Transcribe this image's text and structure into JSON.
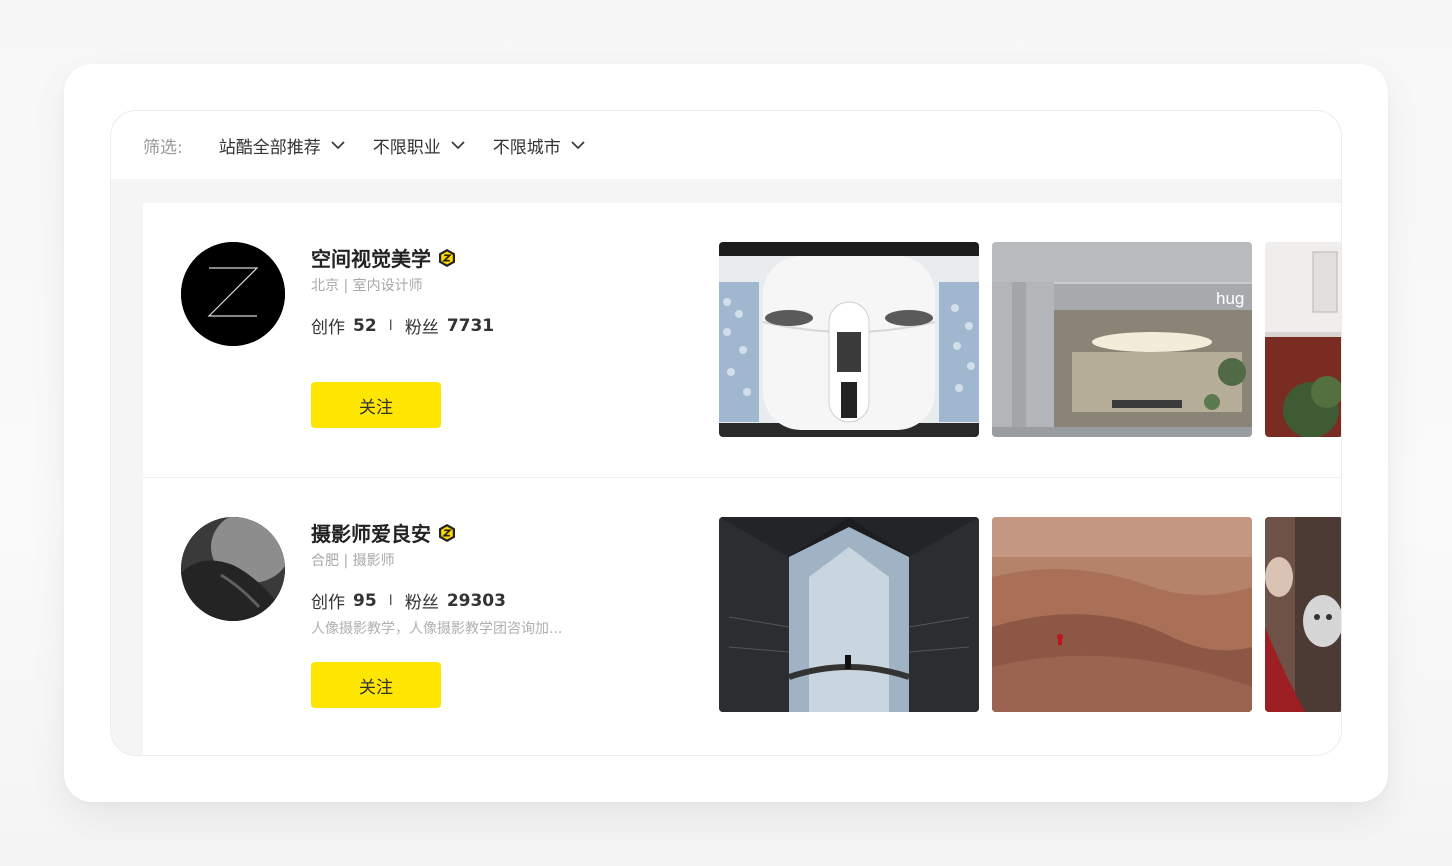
{
  "filter": {
    "label": "筛选:",
    "options": [
      "站酷全部推荐",
      "不限职业",
      "不限城市"
    ]
  },
  "designers": [
    {
      "name": "空间视觉美学",
      "meta": "北京 | 室内设计师",
      "works_label": "创作",
      "works": "52",
      "separator": "I",
      "fans_label": "粉丝",
      "fans": "7731",
      "description": "",
      "follow_label": "关注",
      "thumbnails": [
        "white-interior-photo",
        "hug-storefront-photo",
        "building-exterior-photo"
      ]
    },
    {
      "name": "摄影师爱良安",
      "meta": "合肥 | 摄影师",
      "works_label": "创作",
      "works": "95",
      "separator": "I",
      "fans_label": "粉丝",
      "fans": "29303",
      "description": "人像摄影教学，人像摄影教学团咨询加...",
      "follow_label": "关注",
      "thumbnails": [
        "temple-waterfall-photo",
        "desert-dunes-photo",
        "masked-portrait-photo"
      ]
    }
  ],
  "storefront_sign": "hug",
  "colors": {
    "accent": "#ffe600",
    "verify_badge": "#ffd800",
    "text": "#333333",
    "muted": "#a8a8a8"
  }
}
